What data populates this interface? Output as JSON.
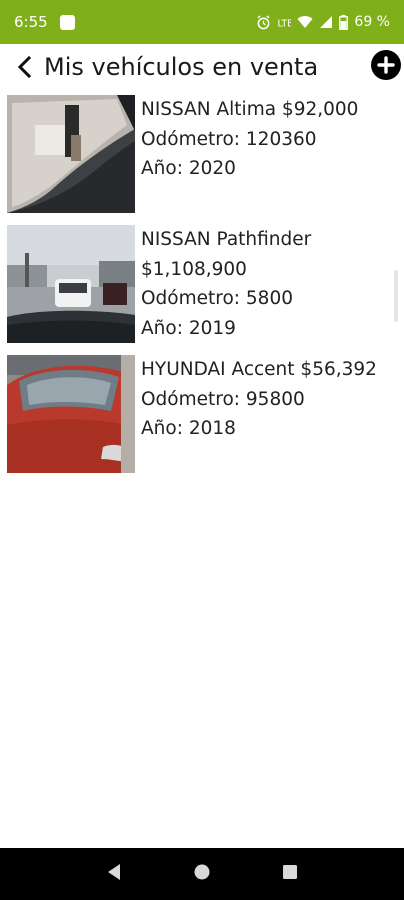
{
  "status_bar": {
    "time": "6:55",
    "battery_percent": "69 %",
    "background_color": "#7fb01a"
  },
  "header": {
    "title": "Mis vehículos en venta",
    "back_icon": "chevron-left-icon",
    "add_icon": "plus-circle-icon"
  },
  "vehicles": [
    {
      "title_line": "NISSAN Altima $92,000",
      "odometer": "Odómetro: 120360",
      "year": "Año: 2020"
    },
    {
      "title_line": "NISSAN Pathfinder",
      "price": "$1,108,900",
      "odometer": "Odómetro: 5800",
      "year": "Año: 2019"
    },
    {
      "title_line": "HYUNDAI Accent $56,392",
      "odometer": "Odómetro: 95800",
      "year": "Año: 2018"
    }
  ],
  "nav_bar": {
    "back_icon": "triangle-back-icon",
    "home_icon": "circle-home-icon",
    "recents_icon": "square-recents-icon"
  }
}
